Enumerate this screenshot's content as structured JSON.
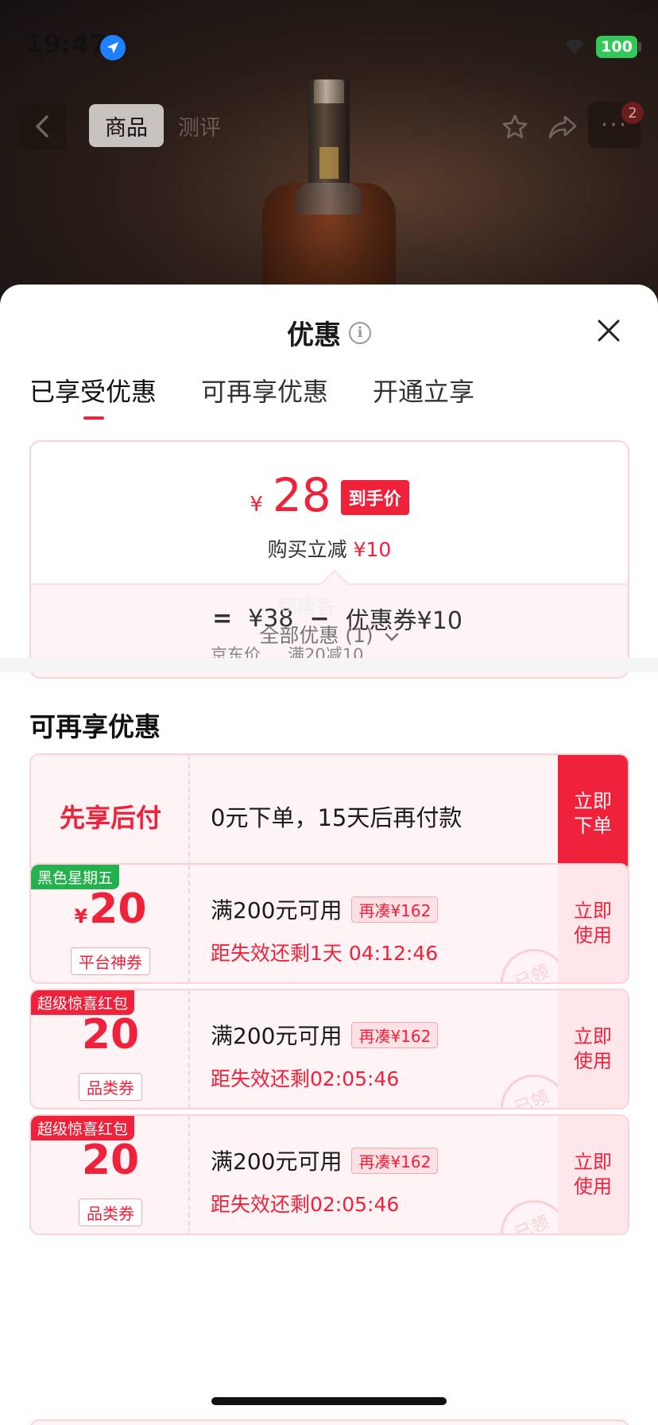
{
  "status": {
    "time": "19:47",
    "battery": "100"
  },
  "nav": {
    "tabs": [
      "商品",
      "测评"
    ],
    "badge_count": "2",
    "more_label": "···"
  },
  "sheet": {
    "title": "优惠",
    "tabs": [
      "已享受优惠",
      "可再享优惠",
      "开通立享"
    ],
    "price": {
      "currency": "¥",
      "amount": "28",
      "tag": "到手价",
      "sub_prefix": "购买立减",
      "sub_amount": "¥10",
      "equals": "=",
      "base_price": "¥38",
      "minus": "−",
      "coupon_part": "优惠券¥10",
      "base_label": "京东价",
      "coupon_label": "满20减10"
    },
    "watermark": "鸭康香",
    "all_offers": "全部优惠 (1)",
    "section_title": "可再享优惠",
    "pay_later": {
      "title": "先享后付",
      "desc": "0元下单，15天后再付款",
      "action": "立即\n下单"
    },
    "coupons": [
      {
        "ribbon": "黑色星期五",
        "ribbon_color": "#22b14c",
        "currency": "¥",
        "amount": "20",
        "kind": "平台神券",
        "condition": "满200元可用",
        "chip": "再凑¥162",
        "expiry": "距失效还剩1天 04:12:46",
        "stamp": "已领",
        "action": "立即\n使用"
      },
      {
        "ribbon": "超级惊喜红包",
        "ribbon_color": "#f0213a",
        "currency": "",
        "amount": "20",
        "kind": "品类券",
        "condition": "满200元可用",
        "chip": "再凑¥162",
        "expiry": "距失效还剩02:05:46",
        "stamp": "已领",
        "action": "立即\n使用"
      },
      {
        "ribbon": "超级惊喜红包",
        "ribbon_color": "#f0213a",
        "currency": "",
        "amount": "20",
        "kind": "品类券",
        "condition": "满200元可用",
        "chip": "再凑¥162",
        "expiry": "距失效还剩02:05:46",
        "stamp": "已领",
        "action": "立即\n使用"
      }
    ]
  },
  "colors": {
    "accent": "#f0213a",
    "success": "#34c759",
    "location": "#1e80ff"
  }
}
